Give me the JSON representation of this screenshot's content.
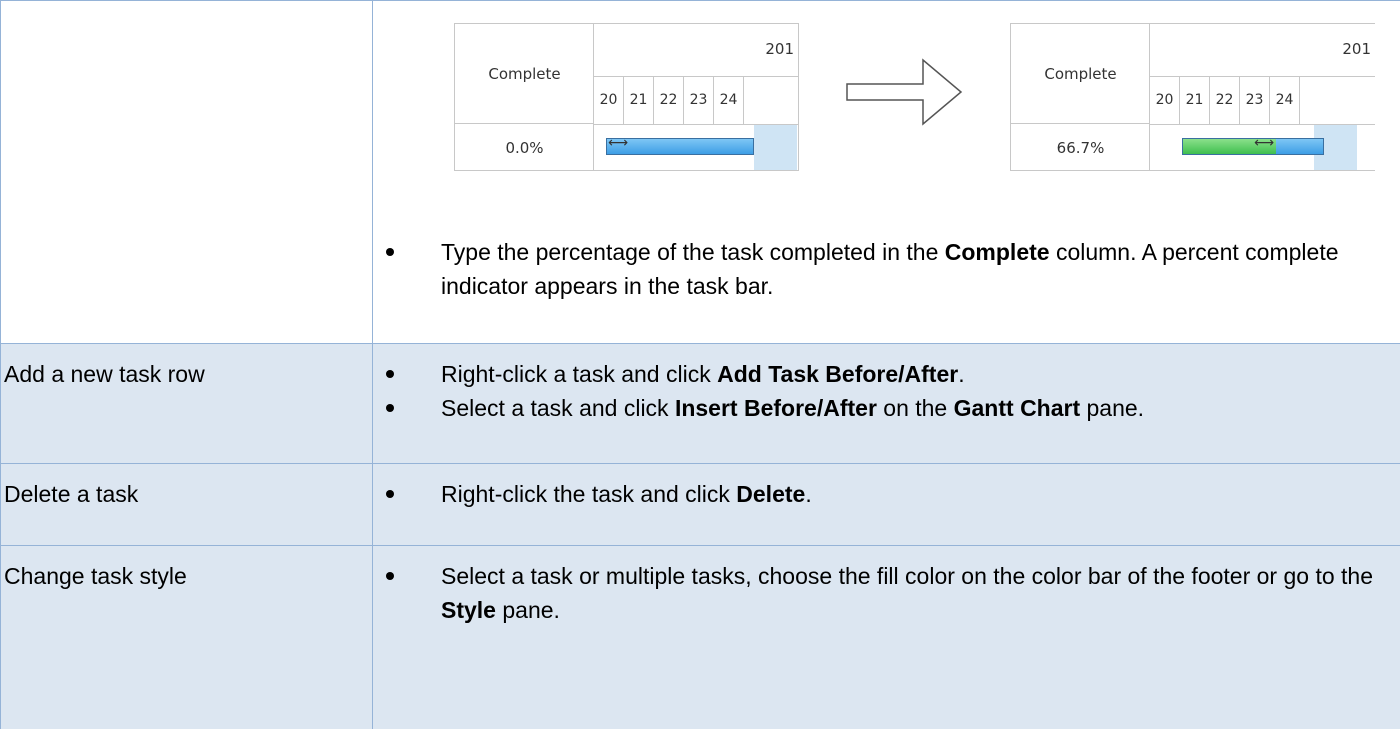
{
  "rows": [
    {
      "feature": "",
      "bullets": [
        {
          "parts": [
            {
              "text": "Type the percentage of the task completed in the ",
              "bold": false
            },
            {
              "text": "Complete",
              "bold": true
            },
            {
              "text": " column. A percent complete indicator appears in the task bar.",
              "bold": false
            }
          ]
        }
      ]
    },
    {
      "feature": "Add a new task row",
      "bullets": [
        {
          "parts": [
            {
              "text": "Right-click a task and click ",
              "bold": false
            },
            {
              "text": "Add Task Before/After",
              "bold": true
            },
            {
              "text": ".",
              "bold": false
            }
          ]
        },
        {
          "parts": [
            {
              "text": "Select a task and click ",
              "bold": false
            },
            {
              "text": "Insert Before/After",
              "bold": true
            },
            {
              "text": " on the ",
              "bold": false
            },
            {
              "text": "Gantt Chart",
              "bold": true
            },
            {
              "text": " pane.",
              "bold": false
            }
          ]
        }
      ]
    },
    {
      "feature": "Delete a task",
      "bullets": [
        {
          "parts": [
            {
              "text": "Right-click the task and click ",
              "bold": false
            },
            {
              "text": "Delete",
              "bold": true
            },
            {
              "text": ".",
              "bold": false
            }
          ]
        }
      ]
    },
    {
      "feature": "Change task style",
      "bullets": [
        {
          "parts": [
            {
              "text": "Select a task or multiple tasks, choose the fill color on the color bar of the footer or go to the ",
              "bold": false
            },
            {
              "text": "Style",
              "bold": true
            },
            {
              "text": " pane.",
              "bold": false
            }
          ]
        }
      ]
    }
  ],
  "gantt_before": {
    "column_header": "Complete",
    "year": "201",
    "days": [
      "20",
      "21",
      "22",
      "23",
      "24"
    ],
    "value": "0.0%",
    "percent_complete": 0.0
  },
  "gantt_after": {
    "column_header": "Complete",
    "year": "201",
    "days": [
      "20",
      "21",
      "22",
      "23",
      "24"
    ],
    "value": "66.7%",
    "percent_complete": 0.667
  },
  "icons": {
    "arrow": "right-arrow-icon",
    "cursor": "resize-cursor-icon"
  },
  "colors": {
    "row_shade": "#dce6f1",
    "border": "#95b3d7",
    "bar_blue": "#3e9ee6",
    "bar_green": "#3fbf4f"
  }
}
